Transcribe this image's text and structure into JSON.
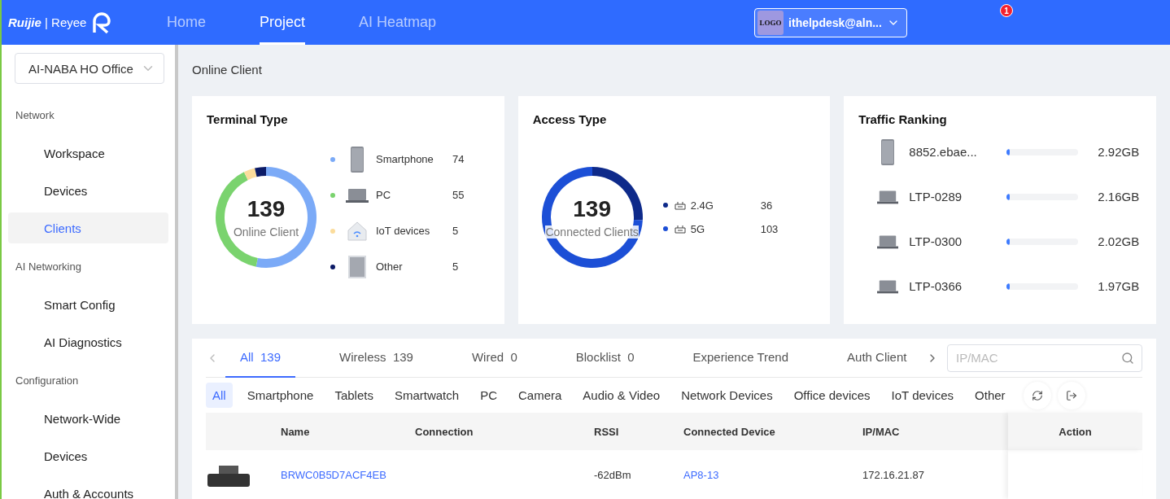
{
  "header": {
    "logo": {
      "brand": "Ruijie",
      "separator": "|",
      "product": "Reyee"
    },
    "nav": [
      {
        "label": "Home",
        "selected": false
      },
      {
        "label": "Project",
        "selected": true
      },
      {
        "label": "AI Heatmap",
        "selected": false
      }
    ],
    "account": {
      "avatar": "LOGO",
      "name": "ithelpdesk@aln..."
    },
    "notification_count": "1"
  },
  "sidebar": {
    "project": "AI-NABA HO Office",
    "groups": [
      {
        "title": "Network",
        "items": [
          {
            "label": "Workspace",
            "selected": false
          },
          {
            "label": "Devices",
            "selected": false
          },
          {
            "label": "Clients",
            "selected": true
          }
        ]
      },
      {
        "title": "AI Networking",
        "items": [
          {
            "label": "Smart Config",
            "selected": false
          },
          {
            "label": "AI Diagnostics",
            "selected": false
          }
        ]
      },
      {
        "title": "Configuration",
        "items": [
          {
            "label": "Network-Wide",
            "selected": false
          },
          {
            "label": "Devices",
            "selected": false
          },
          {
            "label": "Auth & Accounts",
            "selected": false
          }
        ]
      }
    ]
  },
  "breadcrumb": "Online Client",
  "terminal_type": {
    "title": "Terminal Type",
    "total": "139",
    "total_label": "Online Client",
    "legend": [
      {
        "kind": "phone",
        "count": "74",
        "color": "#7baaf7"
      },
      {
        "kind": "laptop",
        "count": "55",
        "color": "#7ad36e"
      },
      {
        "kind": "iot",
        "count": "5",
        "color": "#fbdc9c"
      },
      {
        "kind": "other",
        "count": "5",
        "color": "#0b1a66"
      }
    ],
    "chart_data": {
      "type": "donut",
      "categories": [
        "Smartphone",
        "PC",
        "IoT devices",
        "Other"
      ],
      "values": [
        53.2,
        39.6,
        3.6,
        3.6
      ]
    }
  },
  "access_type": {
    "title": "Access Type",
    "total": "139",
    "total_label": "Connected Clients",
    "legend": [
      {
        "count": "36",
        "color": "#0e2a8a"
      },
      {
        "count": "103",
        "color": "#1c4fd6"
      }
    ],
    "chart_data": {
      "type": "donut",
      "categories": [
        "2.4G",
        "5G"
      ],
      "values": [
        25.9,
        74.1
      ]
    }
  },
  "traffic_ranking": {
    "title": "Traffic Ranking",
    "items": [
      {
        "kind": "phone",
        "name": "8852.ebae...",
        "level": 0.04,
        "value": "2.92GB"
      },
      {
        "kind": "laptop",
        "name": "LTP-0289",
        "level": 0.04,
        "value": "2.16GB"
      },
      {
        "kind": "laptop",
        "name": "LTP-0300",
        "level": 0.04,
        "value": "2.02GB"
      },
      {
        "kind": "laptop",
        "name": "LTP-0366",
        "level": 0.04,
        "value": "1.97GB"
      }
    ]
  },
  "client_tabs": [
    {
      "label": "All",
      "count": "139",
      "selected": true
    },
    {
      "label": "Wireless",
      "count": "139",
      "selected": false
    },
    {
      "label": "Wired",
      "count": "0",
      "selected": false
    },
    {
      "label": "Blocklist",
      "count": "0",
      "selected": false
    },
    {
      "label": "Experience Trend",
      "selected": false
    },
    {
      "label": "Auth Client",
      "selected": false
    }
  ],
  "search": {
    "placeholder": "IP/MAC"
  },
  "categories": [
    {
      "label": "All",
      "selected": true
    },
    {
      "label": "Smartphone",
      "selected": false
    },
    {
      "label": "Tablets",
      "selected": false
    },
    {
      "label": "Smartwatch",
      "selected": false
    },
    {
      "label": "PC",
      "selected": false
    },
    {
      "label": "Camera",
      "selected": false
    },
    {
      "label": "Audio & Video",
      "selected": false
    },
    {
      "label": "Network Devices",
      "selected": false
    },
    {
      "label": "Office devices",
      "selected": false
    },
    {
      "label": "IoT devices",
      "selected": false
    },
    {
      "label": "Other",
      "selected": false
    }
  ],
  "table": {
    "columns": [
      "Name",
      "Connection",
      "RSSI",
      "Connected Device",
      "IP/MAC",
      "Action"
    ],
    "rows": [
      {
        "name": "BRWC0B5D7ACF4EB",
        "rssi": "-62dBm",
        "connected_device": "AP8-13",
        "ip_mac": "172.16.21.87"
      }
    ]
  }
}
